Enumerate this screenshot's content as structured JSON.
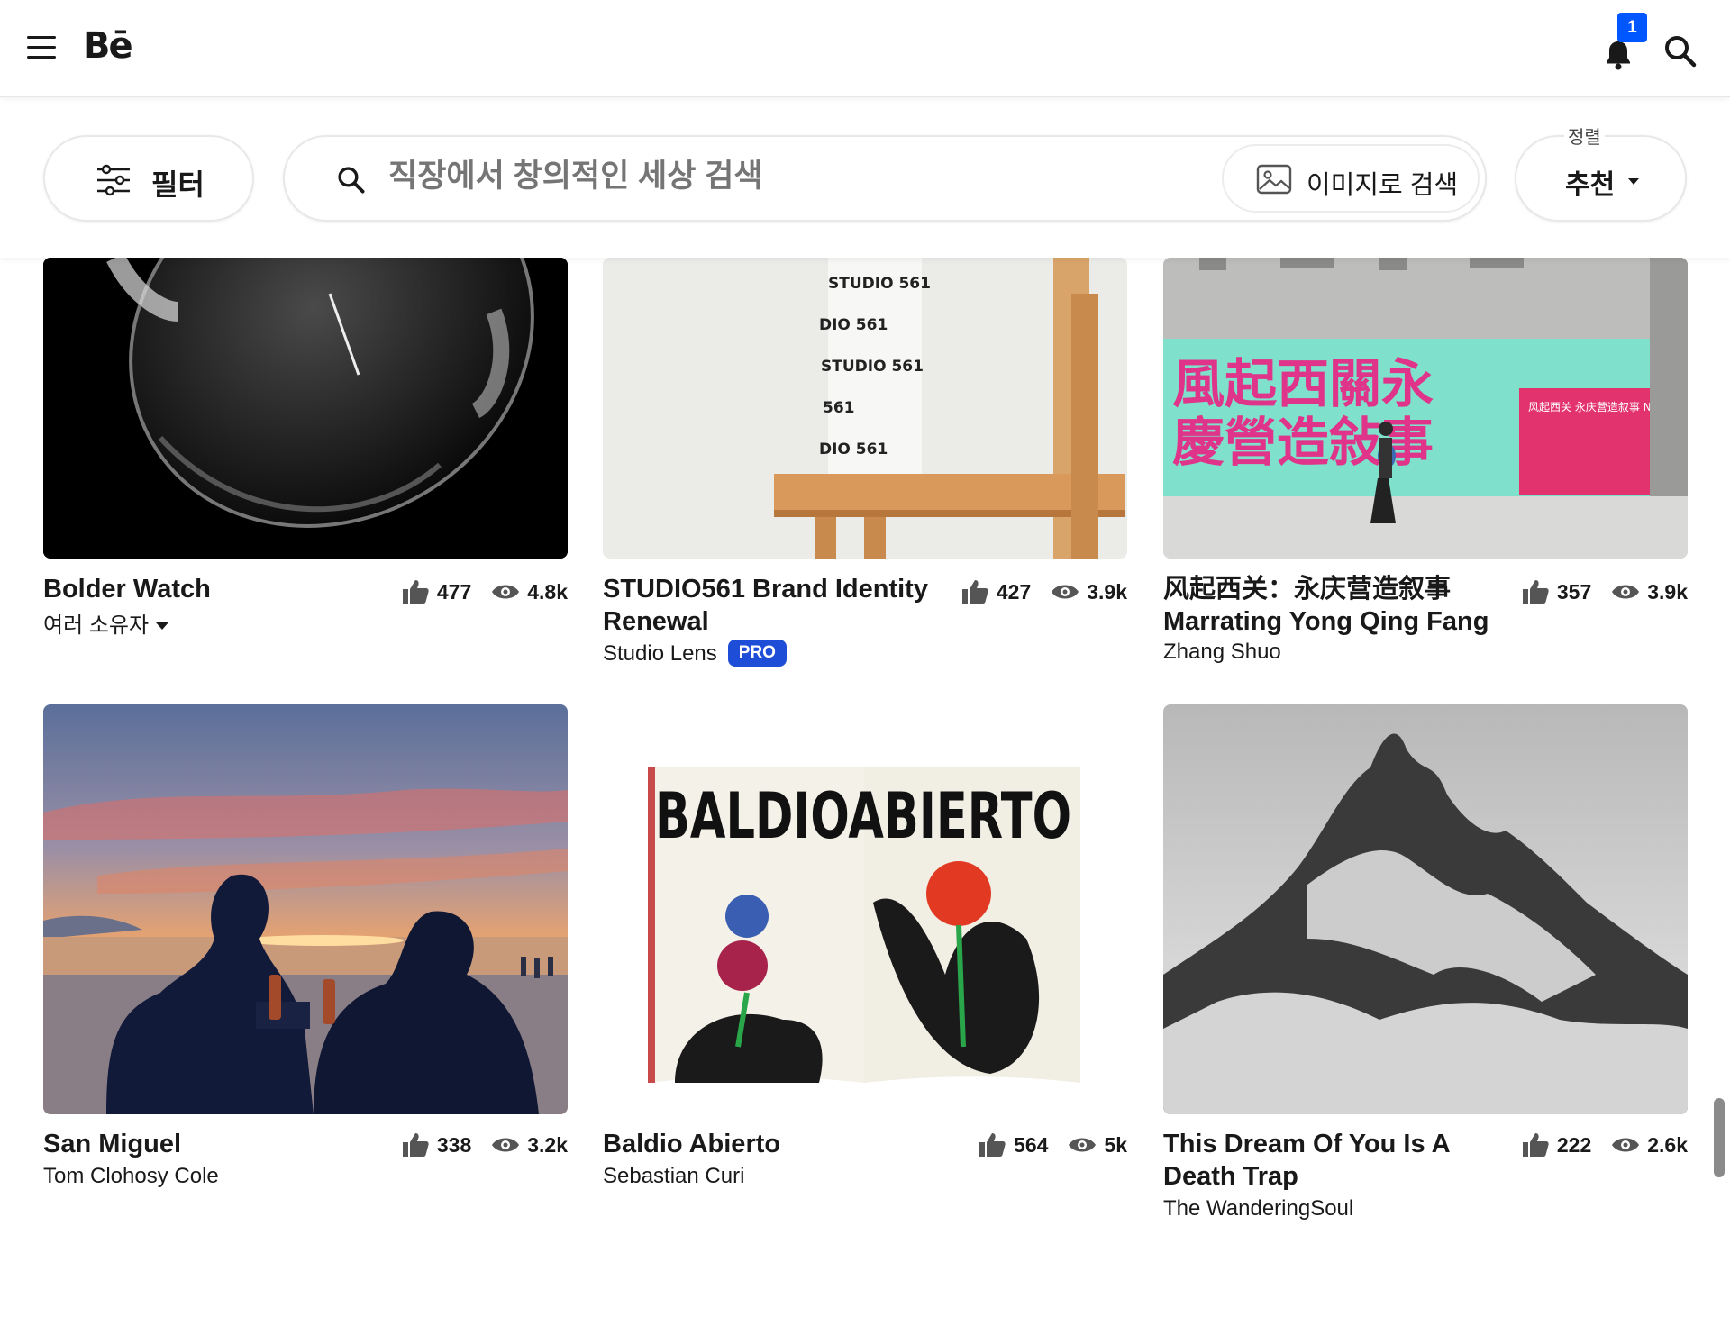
{
  "nav": {
    "logo": "Bē",
    "notification_count": "1"
  },
  "filterbar": {
    "filter_label": "필터",
    "search_placeholder": "직장에서 창의적인 세상 검색",
    "image_search_label": "이미지로 검색",
    "sort_caption": "정렬",
    "sort_value": "추천"
  },
  "projects": [
    {
      "title_lines": [
        "Bolder Watch"
      ],
      "owner": "여러 소유자",
      "likes": "477",
      "views": "4.8k"
    },
    {
      "title_lines": [
        "STUDIO561 Brand Identity",
        "Renewal"
      ],
      "owner": "Studio Lens",
      "badge": "PRO",
      "likes": "427",
      "views": "3.9k"
    },
    {
      "title_lines": [
        "风起西关：永庆营造叙事",
        "Marrating Yong Qing Fang"
      ],
      "owner": "Zhang Shuo",
      "likes": "357",
      "views": "3.9k"
    },
    {
      "title_lines": [
        "San Miguel"
      ],
      "owner": "Tom Clohosy Cole",
      "likes": "338",
      "views": "3.2k"
    },
    {
      "title_lines": [
        "Baldio Abierto"
      ],
      "owner": "Sebastian Curi",
      "likes": "564",
      "views": "5k"
    },
    {
      "title_lines": [
        "This Dream Of You Is A",
        "Death Trap"
      ],
      "owner": "The WanderingSoul",
      "likes": "222",
      "views": "2.6k"
    }
  ],
  "thumb_text": {
    "studio_labels": [
      "STUDIO 561",
      "DIO 561",
      "STUDIO 561",
      "561",
      "DIO 561"
    ],
    "banner_line1": "風起西關永",
    "banner_line2": "慶營造敍事",
    "banner_panel": "风起西关 永庆营造叙事 Narrating Yong Qing Fang",
    "magazine_title": "BALDIOABIERTO"
  },
  "icons": {
    "menu": "hamburger-icon",
    "bell": "bell-icon",
    "search": "search-icon",
    "filter": "sliders-icon",
    "image": "image-icon",
    "like": "thumbs-up-icon",
    "view": "eye-icon"
  },
  "colors": {
    "accent": "#0057ff",
    "pro": "#1e4dd8",
    "text": "#191919"
  }
}
